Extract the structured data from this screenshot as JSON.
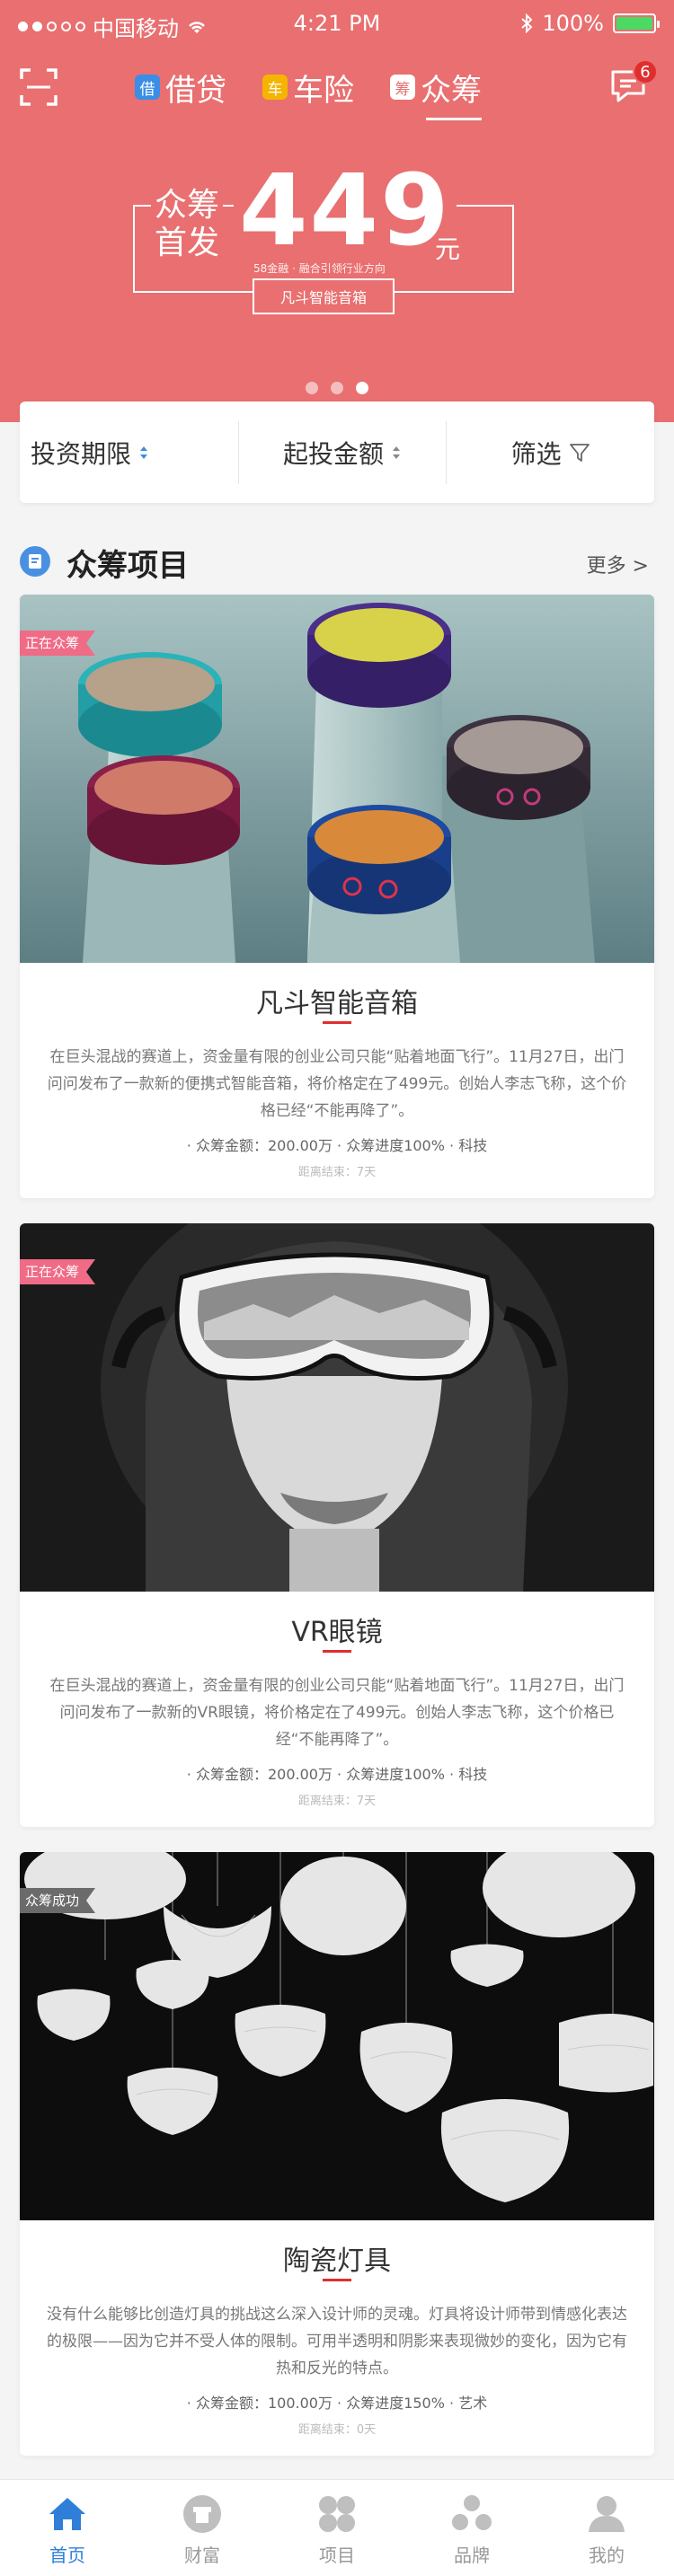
{
  "status_bar": {
    "carrier": "中国移动",
    "time": "4:21 PM",
    "battery": "100%"
  },
  "nav": {
    "tabs": [
      {
        "tag": "借",
        "label": "借贷",
        "color": "#3a8ee6"
      },
      {
        "tag": "车",
        "label": "车险",
        "color": "#f5b400"
      },
      {
        "tag": "筹",
        "label": "众筹",
        "color": "#ffffff"
      }
    ],
    "message_count": "6"
  },
  "banner": {
    "title_line1": "众筹",
    "title_line2": "首发",
    "number": "449",
    "unit": "元",
    "subtitle": "58金融 · 融合引领行业方向",
    "button": "凡斗智能音箱",
    "pages": 3,
    "active_page": 3
  },
  "filter": {
    "items": [
      "投资期限",
      "起投金额",
      "筛选"
    ]
  },
  "section": {
    "title": "众筹项目",
    "more": "更多 >"
  },
  "projects": [
    {
      "ribbon": "正在众筹",
      "ribbon_color": "#f06b86",
      "title": "凡斗智能音箱",
      "desc": "在巨头混战的赛道上，资金量有限的创业公司只能“贴着地面飞行”。11月27日，出门问问发布了一款新的便携式智能音箱，将价格定在了499元。创始人李志飞称，这个价格已经“不能再降了”。",
      "meta": "· 众筹金额：200.00万 · 众筹进度100% · 科技",
      "end": "距离结束：7天"
    },
    {
      "ribbon": "正在众筹",
      "ribbon_color": "#f06b86",
      "title": "VR眼镜",
      "desc": "在巨头混战的赛道上，资金量有限的创业公司只能“贴着地面飞行”。11月27日，出门问问发布了一款新的VR眼镜，将价格定在了499元。创始人李志飞称，这个价格已经“不能再降了”。",
      "meta": "· 众筹金额：200.00万 · 众筹进度100% · 科技",
      "end": "距离结束：7天"
    },
    {
      "ribbon": "众筹成功",
      "ribbon_color": "#6b6b6b",
      "title": "陶瓷灯具",
      "desc": "没有什么能够比创造灯具的挑战这么深入设计师的灵魂。灯具将设计师带到情感化表达的极限——因为它并不受人体的限制。可用半透明和阴影来表现微妙的变化，因为它有热和反光的特点。",
      "meta": "· 众筹金额：100.00万 · 众筹进度150% · 艺术",
      "end": "距离结束：0天"
    }
  ],
  "tabbar": {
    "items": [
      {
        "label": "首页",
        "icon": "home-icon"
      },
      {
        "label": "财富",
        "icon": "wallet-icon"
      },
      {
        "label": "项目",
        "icon": "grid-icon"
      },
      {
        "label": "品牌",
        "icon": "brand-icon"
      },
      {
        "label": "我的",
        "icon": "user-icon"
      }
    ],
    "active_color": "#2f7fd8"
  },
  "colors": {
    "hero": "#e96f70",
    "accent": "#e02e2e"
  }
}
